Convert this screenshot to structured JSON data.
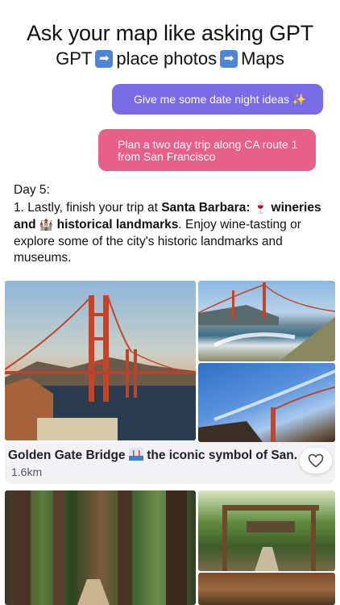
{
  "header": {
    "title": "Ask your map like asking GPT",
    "subtitle_parts": [
      "GPT",
      "place photos",
      "Maps"
    ],
    "arrow_glyph": "➡"
  },
  "prompts": [
    {
      "text": "Give me some date night ideas ✨",
      "color": "#7a6be6"
    },
    {
      "text": "Plan a two day trip along CA route 1 from San Francisco",
      "color": "#e7608a"
    }
  ],
  "answer": {
    "day": "Day 5:",
    "p1": "1. Lastly, finish your trip at ",
    "bold1": "Santa Barbara:",
    "emoji1": "🍷",
    "bold2a": "wineries and",
    "emoji2": "🏰",
    "bold2b": "historical landmarks",
    "p2": ". Enjoy wine-tasting or explore some of the city's historic landmarks and museums."
  },
  "place_card": {
    "title_before": "Golden Gate Bridge",
    "title_icon": "bridge-postcard-icon",
    "title_after": "the iconic symbol of San...",
    "distance": "1.6km"
  },
  "icons": {
    "favorite": "heart-outline-icon"
  },
  "colors": {
    "bridge": "#c0452a",
    "accent_purple": "#7a6be6",
    "accent_pink": "#e7608a"
  }
}
